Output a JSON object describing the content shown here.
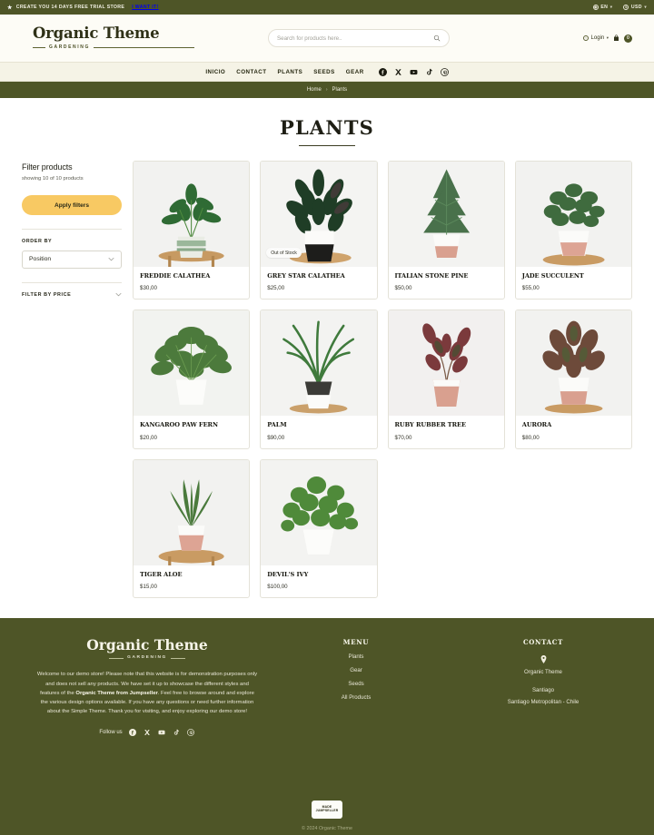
{
  "topbar": {
    "star_icon": "star-icon",
    "promo_text": "CREATE YOU 14 DAYS FREE TRIAL STORE",
    "cta_label": "I WANT IT!",
    "language": "EN",
    "currency": "USD"
  },
  "header": {
    "logo_title": "Organic Theme",
    "logo_subtitle": "GARDENING",
    "search_placeholder": "Search for products here..",
    "search_value": "",
    "login_label": "Login",
    "cart_count": "0"
  },
  "nav": {
    "items": [
      {
        "label": "INICIO"
      },
      {
        "label": "CONTACT"
      },
      {
        "label": "PLANTS"
      },
      {
        "label": "SEEDS"
      },
      {
        "label": "GEAR"
      }
    ],
    "socials": [
      "facebook-icon",
      "x-icon",
      "youtube-icon",
      "tiktok-icon",
      "pinterest-icon"
    ]
  },
  "breadcrumb": {
    "home": "Home",
    "separator": "›",
    "current": "Plants"
  },
  "page": {
    "title": "PLANTS"
  },
  "sidebar": {
    "filter_title": "Filter products",
    "showing_text": "showing 10 of 10 products",
    "apply_label": "Apply filters",
    "order_by_label": "ORDER BY",
    "order_by_value": "Position",
    "order_by_options": [
      "Position"
    ],
    "filter_price_label": "FILTER BY PRICE"
  },
  "products": [
    {
      "name": "FREDDIE CALATHEA",
      "price": "$30,00",
      "badge": ""
    },
    {
      "name": "GREY STAR CALATHEA",
      "price": "$25,00",
      "badge": "Out of Stock"
    },
    {
      "name": "ITALIAN STONE PINE",
      "price": "$50,00",
      "badge": ""
    },
    {
      "name": "JADE SUCCULENT",
      "price": "$55,00",
      "badge": ""
    },
    {
      "name": "KANGAROO PAW FERN",
      "price": "$20,00",
      "badge": ""
    },
    {
      "name": "PALM",
      "price": "$90,00",
      "badge": ""
    },
    {
      "name": "RUBY RUBBER TREE",
      "price": "$70,00",
      "badge": ""
    },
    {
      "name": "AURORA",
      "price": "$80,00",
      "badge": ""
    },
    {
      "name": "TIGER ALOE",
      "price": "$15,00",
      "badge": ""
    },
    {
      "name": "DEVIL'S IVY",
      "price": "$100,00",
      "badge": ""
    }
  ],
  "footer": {
    "logo_title": "Organic Theme",
    "logo_subtitle": "GARDENING",
    "about_part1": "Welcome to our demo store! Please note that this website is for demonstration purposes only and does not sell any products. We have set it up to showcase the different styles and features of the ",
    "about_bold": "Organic Theme from Jumpseller",
    "about_part2": ". Feel free to browse around and explore the various design options available. If you have any questions or need further information about the Simple Theme. Thank you for visiting, and enjoy exploring our demo store!",
    "follow_label": "Follow us",
    "menu_heading": "MENU",
    "menu_items": [
      "Plants",
      "Gear",
      "Seeds",
      "All Products"
    ],
    "contact_heading": "CONTACT",
    "contact_name": "Organic Theme",
    "contact_city": "Santiago",
    "contact_region": "Santiago Metropolitan - Chile",
    "badge_line1": "MADE",
    "badge_line2": "JUMPSELLER",
    "copyright": "© 2024 Organic Theme"
  },
  "colors": {
    "olive": "#4e5527",
    "cream": "#f5f3e6",
    "amber": "#f8c963"
  }
}
